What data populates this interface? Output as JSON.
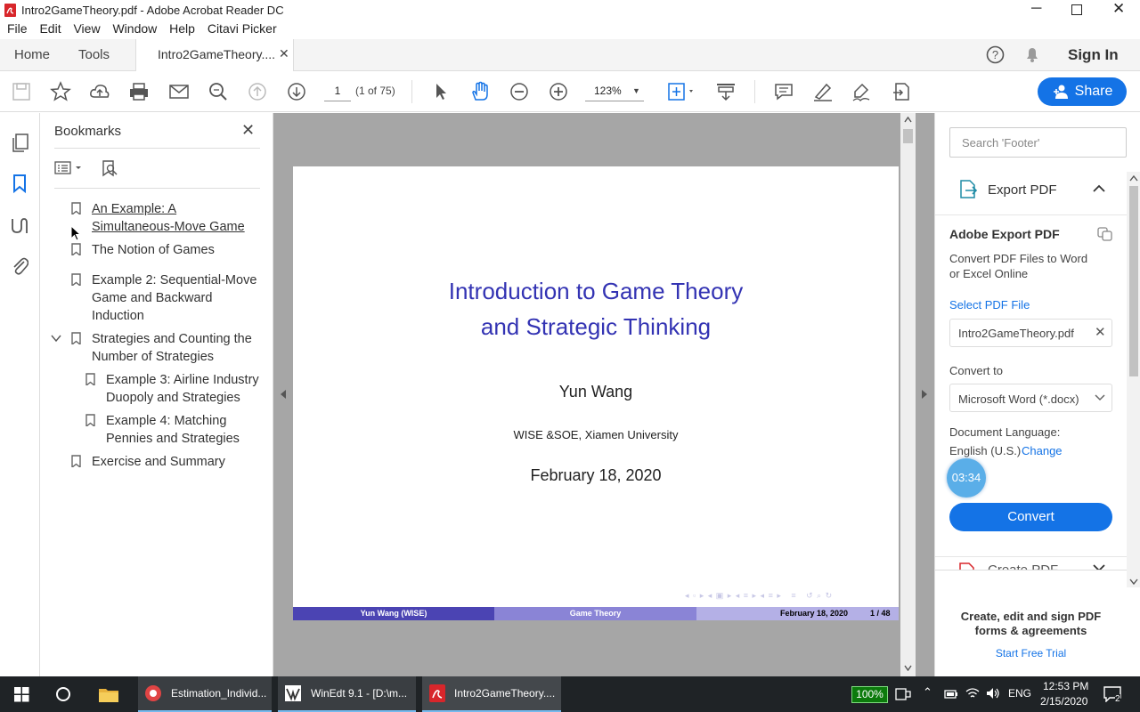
{
  "window": {
    "title": "Intro2GameTheory.pdf - Adobe Acrobat Reader DC"
  },
  "menu": [
    "File",
    "Edit",
    "View",
    "Window",
    "Help",
    "Citavi Picker"
  ],
  "tabs": {
    "home": "Home",
    "tools": "Tools",
    "document": "Intro2GameTheory...."
  },
  "header": {
    "sign_in": "Sign In"
  },
  "toolbar": {
    "page_current": "1",
    "page_total": "(1 of 75)",
    "zoom": "123%",
    "share": "Share"
  },
  "bookmarks": {
    "title": "Bookmarks",
    "items": [
      {
        "line1": "An Example: A",
        "line2": "Simultaneous-Move Game"
      },
      {
        "line1": "The Notion of Games",
        "line2": ""
      },
      {
        "line1": "Example 2: Sequential-Move",
        "line2": "Game and Backward",
        "line3": "Induction"
      },
      {
        "line1": "Strategies and Counting the",
        "line2": "Number of Strategies"
      },
      {
        "line1": "Example 3: Airline Industry",
        "line2": "Duopoly and Strategies"
      },
      {
        "line1": "Example 4: Matching",
        "line2": "Pennies and Strategies"
      },
      {
        "line1": "Exercise and Summary",
        "line2": ""
      }
    ]
  },
  "slide": {
    "title_line1": "Introduction to Game Theory",
    "title_line2": "and Strategic Thinking",
    "author": "Yun Wang",
    "affiliation": "WISE &SOE, Xiamen University",
    "date": "February 18, 2020",
    "footer_author": "Yun Wang (WISE)",
    "footer_title": "Game Theory",
    "footer_date": "February 18, 2020",
    "footer_page": "1 / 48"
  },
  "right_panel": {
    "search_placeholder": "Search 'Footer'",
    "export_pdf": "Export PDF",
    "adobe_export_pdf": "Adobe Export PDF",
    "description": "Convert PDF Files to Word",
    "description2": "or Excel Online",
    "select_pdf_file": "Select PDF File",
    "file_name": "Intro2GameTheory.pdf",
    "convert_to": "Convert to",
    "format": "Microsoft Word (*.docx)",
    "doc_language_label": "Document Language:",
    "doc_language": "English (U.S.)",
    "change": "Change",
    "timer": "03:34",
    "convert": "Convert",
    "create_pdf": "Create PDF",
    "promo_line1": "Create, edit and sign PDF",
    "promo_line2": "forms & agreements",
    "trial": "Start Free Trial"
  },
  "taskbar": {
    "apps": [
      "Estimation_Individ...",
      "WinEdt 9.1 - [D:\\m...",
      "Intro2GameTheory...."
    ],
    "battery": "100%",
    "lang": "ENG",
    "time": "12:53 PM",
    "date": "2/15/2020",
    "notifications": "2"
  },
  "colors": {
    "accent": "#1473e6",
    "slide_title": "#3333b3",
    "footer_dark": "#4b44b3",
    "footer_mid": "#8a84d6",
    "footer_light": "#b4b0e6"
  }
}
